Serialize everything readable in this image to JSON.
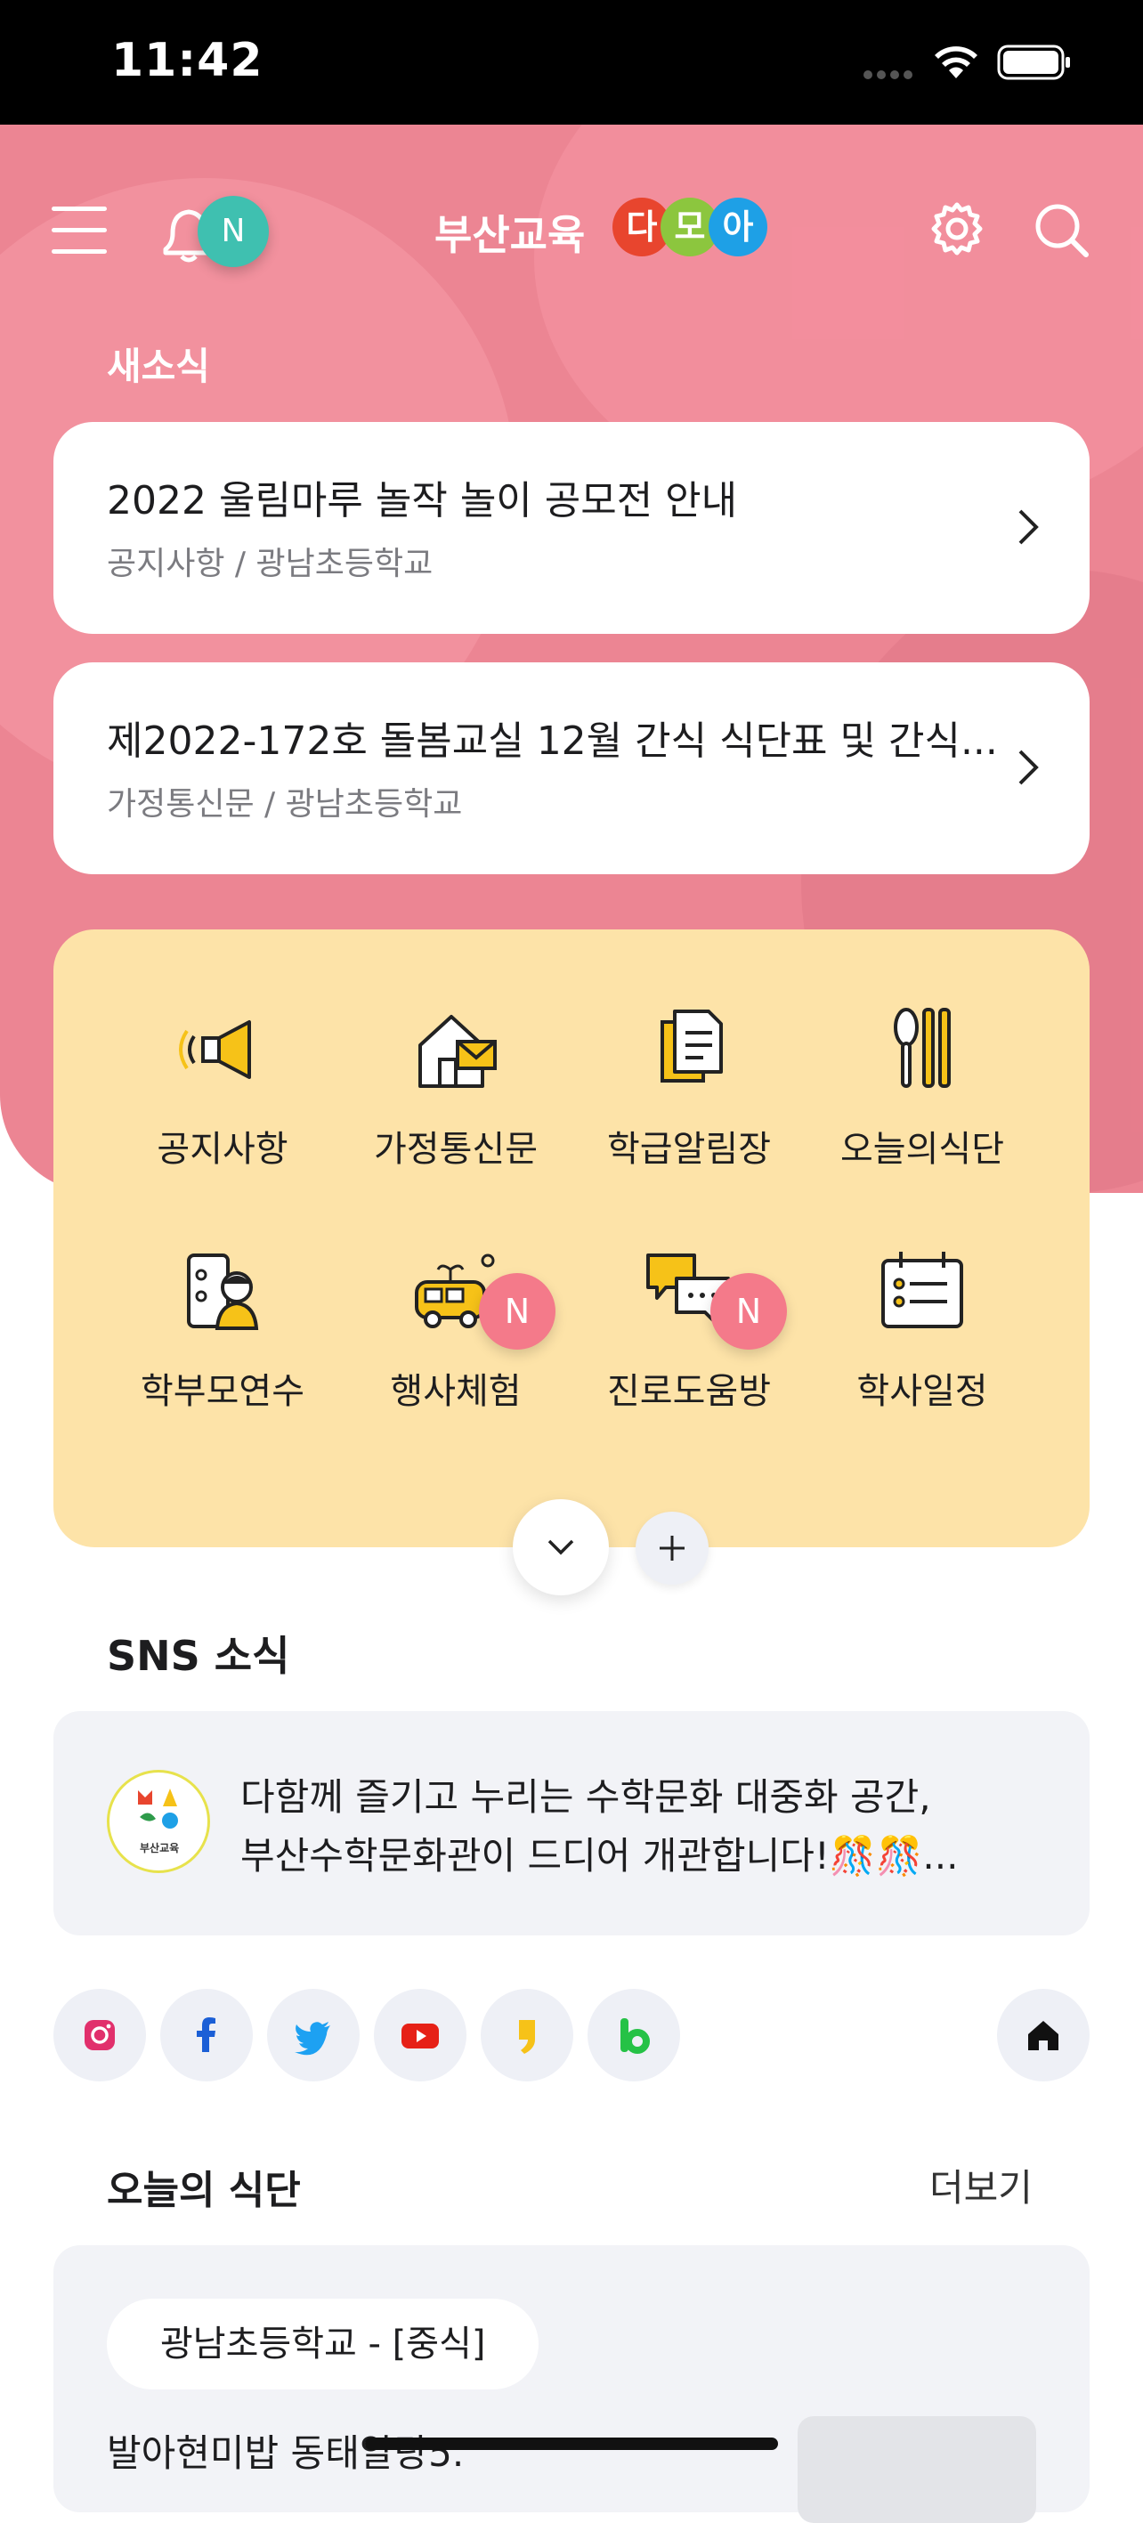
{
  "status_bar": {
    "time": "11:42"
  },
  "header": {
    "notification_badge": "N",
    "logo_text": "부산교육",
    "logo_badge_chars": [
      "다",
      "모",
      "아"
    ],
    "logo_badge_colors": [
      "#e8452e",
      "#8cc63e",
      "#1ea0e6"
    ]
  },
  "news": {
    "section_title": "새소식",
    "items": [
      {
        "title": "2022 울림마루 놀작 놀이 공모전 안내",
        "subtitle": "공지사항 / 광남초등학교"
      },
      {
        "title": "제2022-172호 돌봄교실 12월 간식 식단표 및 간식...",
        "subtitle": "가정통신문 / 광남초등학교"
      }
    ]
  },
  "menu": {
    "items": [
      {
        "label": "공지사항",
        "icon": "megaphone-icon"
      },
      {
        "label": "가정통신문",
        "icon": "home-letter-icon"
      },
      {
        "label": "학급알림장",
        "icon": "document-icon"
      },
      {
        "label": "오늘의식단",
        "icon": "spoon-chopsticks-icon"
      },
      {
        "label": "학부모연수",
        "icon": "parent-training-icon"
      },
      {
        "label": "행사체험",
        "icon": "bus-event-icon",
        "badge": "N"
      },
      {
        "label": "진로도움방",
        "icon": "chat-bubbles-icon",
        "badge": "N"
      },
      {
        "label": "학사일정",
        "icon": "calendar-icon"
      }
    ]
  },
  "sns": {
    "section_title": "SNS 소식",
    "avatar_label": "부산교육",
    "post_line1": "다함께 즐기고 누리는 수학문화 대중화 공간,",
    "post_line2": "부산수학문화관이 드디어 개관합니다!🎊🎊...",
    "channels": [
      "instagram-icon",
      "facebook-icon",
      "twitter-icon",
      "youtube-icon",
      "kakao-story-icon",
      "band-icon"
    ]
  },
  "meal": {
    "section_title": "오늘의 식단",
    "more_label": "더보기",
    "school": "광남초등학교 - [중식]",
    "menu_text": "발아현미밥 동태알탕5."
  },
  "colors": {
    "hero_pink": "#ec8593",
    "menu_yellow": "#fde3a8",
    "badge_teal": "#3fc0b0",
    "badge_pink": "#f47a8a"
  }
}
